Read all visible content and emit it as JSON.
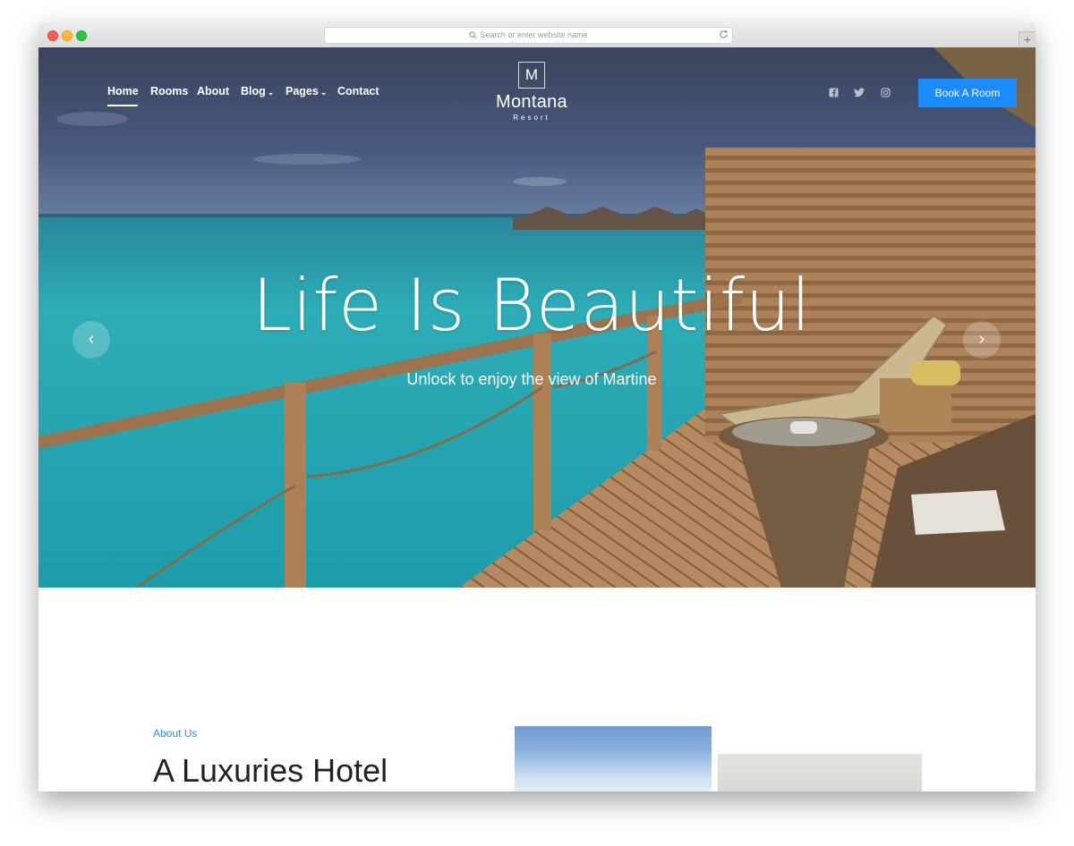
{
  "browser": {
    "url_placeholder": "Search or enter website name",
    "new_tab_label": "+"
  },
  "nav": {
    "items": [
      {
        "label": "Home",
        "active": true
      },
      {
        "label": "Rooms"
      },
      {
        "label": "About"
      },
      {
        "label": "Blog",
        "dropdown": true
      },
      {
        "label": "Pages",
        "dropdown": true
      },
      {
        "label": "Contact"
      }
    ],
    "chevron": "⌄"
  },
  "logo": {
    "letter": "M",
    "name": "Montana",
    "tagline": "Resort"
  },
  "social": {
    "icons": [
      "facebook-icon",
      "twitter-icon",
      "instagram-icon"
    ]
  },
  "cta": {
    "label": "Book A Room",
    "color": "#1a8cff"
  },
  "hero": {
    "title": "Life Is Beautiful",
    "subtitle": "Unlock to enjoy the view of Martine",
    "prev_symbol": "‹",
    "next_symbol": "›"
  },
  "about": {
    "label": "About Us",
    "title": "A Luxuries Hotel",
    "accent": "#2f8ee6"
  }
}
